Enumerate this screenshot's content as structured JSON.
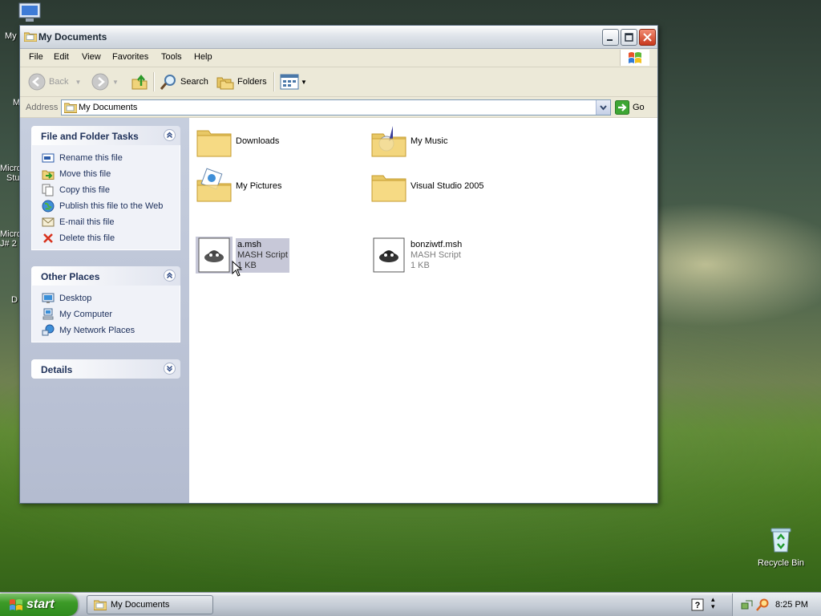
{
  "desktop": {
    "icons": [
      {
        "label": "Recycle Bin"
      }
    ],
    "partial_labels": [
      "My",
      "M",
      "Micro",
      "Stu",
      "Micro",
      "J# 2",
      "D"
    ]
  },
  "window": {
    "title": "My Documents",
    "menu": [
      "File",
      "Edit",
      "View",
      "Favorites",
      "Tools",
      "Help"
    ],
    "toolbar": {
      "back": "Back",
      "search": "Search",
      "folders": "Folders"
    },
    "address": {
      "label": "Address",
      "value": "My Documents",
      "go": "Go"
    },
    "left_pane": {
      "file_tasks": {
        "title": "File and Folder Tasks",
        "items": [
          "Rename this file",
          "Move this file",
          "Copy this file",
          "Publish this file to the Web",
          "E-mail this file",
          "Delete this file"
        ]
      },
      "other_places": {
        "title": "Other Places",
        "items": [
          "Desktop",
          "My Computer",
          "My Network Places"
        ]
      },
      "details": {
        "title": "Details"
      }
    },
    "files": [
      {
        "name": "Downloads",
        "type": "",
        "size": ""
      },
      {
        "name": "My Music",
        "type": "",
        "size": ""
      },
      {
        "name": "My Pictures",
        "type": "",
        "size": ""
      },
      {
        "name": "Visual Studio 2005",
        "type": "",
        "size": ""
      },
      {
        "name": "a.msh",
        "type": "MASH Script",
        "size": "1 KB"
      },
      {
        "name": "bonziwtf.msh",
        "type": "MASH Script",
        "size": "1 KB"
      }
    ]
  },
  "taskbar": {
    "start": "start",
    "task_button": "My Documents",
    "clock": "8:25 PM"
  },
  "colors": {
    "accent": "#316ac5",
    "start_green": "#3c9a27",
    "selection": "#c7c8d8"
  }
}
